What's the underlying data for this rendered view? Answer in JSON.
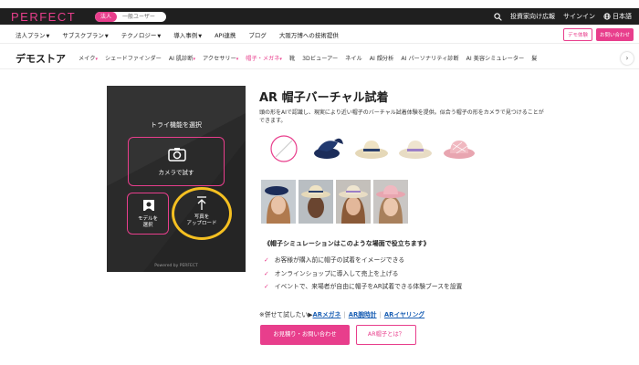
{
  "header": {
    "logo": "PERFECT",
    "toggle_on": "法人",
    "toggle_off": "一般ユーザー",
    "investor": "投資家向け広報",
    "signin": "サインイン",
    "lang": "日本語"
  },
  "nav1": {
    "items": [
      "法人プラン",
      "サブスクプラン",
      "テクノロジー",
      "導入事例",
      "API連携",
      "ブログ",
      "大阪万博への技術提供"
    ],
    "demo_button": "デモ体験",
    "contact_button": "お問い合わせ"
  },
  "nav2": {
    "title": "デモストア",
    "cats": [
      "メイク",
      "シェードファインダー",
      "AI 肌診断",
      "アクセサリー",
      "帽子・メガネ",
      "靴",
      "3Dビューアー",
      "ネイル",
      "AI 顔分析",
      "AI パーソナリティ診断",
      "AI 美容シミュレーター",
      "髪"
    ],
    "active": "帽子・メガネ"
  },
  "panel": {
    "title": "トライ機能を選択",
    "camera": "カメラで試す",
    "model_line1": "モデルを",
    "model_line2": "選択",
    "upload_line1": "写真を",
    "upload_line2": "アップロード",
    "powered": "Powered by PERFECT"
  },
  "product": {
    "title": "AR 帽子バーチャル試着",
    "desc": "頭の形をAIで認識し、現実により近い帽子のバーチャル試着体験を提供。似合う帽子の形をカメラで見つけることができます。",
    "question": "《帽子シミュレーションはこのような場面で役立ちます》",
    "bullets": [
      "お客様が購入前に帽子の試着をイメージできる",
      "オンラインショップに導入して売上を上げる",
      "イベントで、来場者が自由に帽子をAR試着できる体験ブースを設置"
    ],
    "also_prefix": "※併せて試したい▶",
    "links": [
      "ARメガネ",
      "AR腕時計",
      "ARイヤリング"
    ],
    "cta_contact": "お見積り・お問い合わせ",
    "cta_about": "AR帽子とは？"
  },
  "colors": {
    "accent": "#e83e8c",
    "highlight": "#f5c021",
    "panel": "#2a2a2a"
  }
}
